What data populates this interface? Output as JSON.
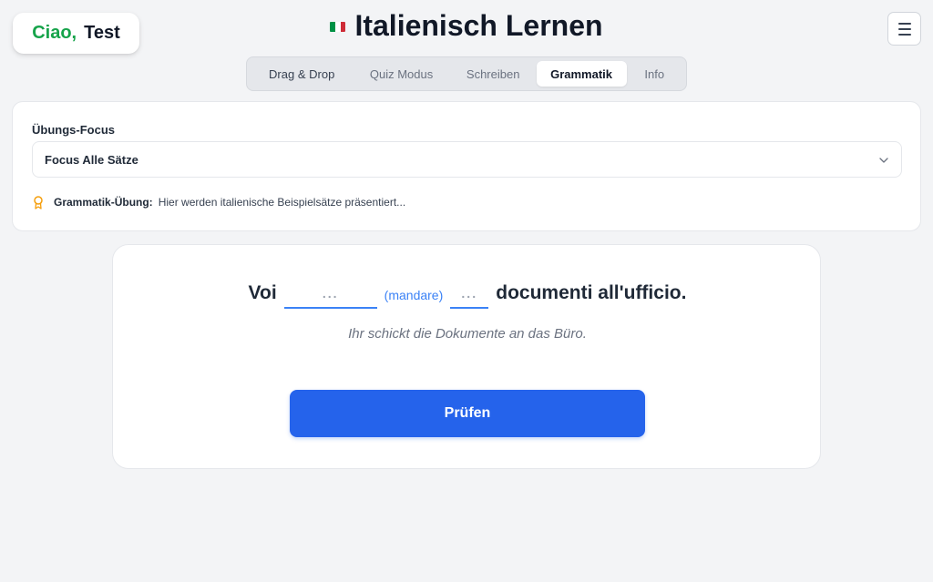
{
  "greeting": {
    "hello": "Ciao,",
    "name": "Test"
  },
  "header": {
    "title": "Italienisch Lernen",
    "flag_colors": [
      "#009246",
      "#ffffff",
      "#ce2b37"
    ]
  },
  "menu": {
    "icon": "hamburger-menu-icon"
  },
  "tabs": [
    {
      "label": "Drag & Drop",
      "active": false
    },
    {
      "label": "Quiz Modus",
      "active": false
    },
    {
      "label": "Schreiben",
      "active": false
    },
    {
      "label": "Grammatik",
      "active": true
    },
    {
      "label": "Info",
      "active": false
    }
  ],
  "focus": {
    "label": "Übungs-Focus",
    "selected": "Focus Alle Sätze",
    "hint_title": "Grammatik-Übung:",
    "hint_text": "Hier werden italienische Beispielsätze präsentiert..."
  },
  "exercise": {
    "word_before": "Voi",
    "blank1_placeholder": "...",
    "verb_hint": "(mandare)",
    "blank2_placeholder": "...",
    "word_after": "documenti all'ufficio.",
    "translation": "Ihr schickt die Dokumente an das Büro.",
    "check_label": "Prüfen"
  },
  "colors": {
    "accent": "#2563eb",
    "greeting": "#16a34a",
    "medal": "#f59e0b"
  }
}
